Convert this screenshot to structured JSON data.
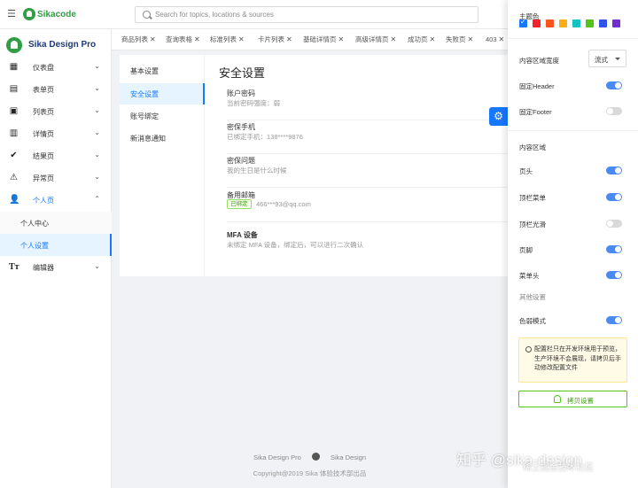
{
  "topbar": {
    "brand": "Sikacode",
    "search_placeholder": "Search for topics, locations & sources"
  },
  "sidebar": {
    "brand": "Sika Design Pro",
    "items": [
      {
        "label": "仪表盘",
        "icon": "dashboard-icon"
      },
      {
        "label": "表单页",
        "icon": "form-icon"
      },
      {
        "label": "列表页",
        "icon": "list-icon"
      },
      {
        "label": "详情页",
        "icon": "detail-icon"
      },
      {
        "label": "结果页",
        "icon": "result-icon"
      },
      {
        "label": "异常页",
        "icon": "warning-icon"
      },
      {
        "label": "个人页",
        "icon": "user-icon"
      },
      {
        "label": "编辑器",
        "icon": "editor-icon"
      }
    ],
    "sub_items": [
      {
        "label": "个人中心"
      },
      {
        "label": "个人设置"
      }
    ]
  },
  "tabs": [
    "商品列表",
    "查询表格",
    "标准列表",
    "卡片列表",
    "基础详情页",
    "高级详情页",
    "成功页",
    "失败页",
    "403"
  ],
  "settings_nav": [
    "基本设置",
    "安全设置",
    "账号绑定",
    "新消息通知"
  ],
  "security": {
    "title": "安全设置",
    "rows": [
      {
        "title": "账户密码",
        "desc": "当前密码强度：弱"
      },
      {
        "title": "密保手机",
        "desc": "已绑定手机：138****9876"
      },
      {
        "title": "密保问题",
        "desc": "我的生日是什么时候"
      },
      {
        "title": "备用邮箱",
        "badge": "已绑定",
        "desc": "466***93@qq.com"
      },
      {
        "title": "MFA 设备",
        "desc": "未绑定 MFA 设备，绑定后，可以进行二次确认"
      }
    ]
  },
  "footer": {
    "link1": "Sika Design Pro",
    "link2": "Sika Design",
    "copyright": "Copyright@2019 Sika 体验技术部出品"
  },
  "drawer": {
    "theme_color_label": "主题色",
    "colors": [
      "#1677ff",
      "#f5222d",
      "#fa541c",
      "#faad14",
      "#13c2c2",
      "#52c41a",
      "#2f54eb",
      "#722ed1"
    ],
    "content_width_label": "内容区域宽度",
    "content_width_value": "流式",
    "fixed_header_label": "固定Header",
    "fixed_footer_label": "固定Footer",
    "content_area_label": "内容区域",
    "header_label": "页头",
    "top_menu_label": "顶栏菜单",
    "top_smooth_label": "顶栏光滑",
    "page_footer_label": "页脚",
    "menu_header_label": "菜单头",
    "other_settings_label": "其他设置",
    "color_weak_label": "色弱模式",
    "notice": "配置栏只在开发环境用于预览，生产环境不会展现，请拷贝后手动修改配置文件",
    "copy_button": "拷贝设置"
  },
  "watermark": {
    "main": "知乎 @sika-design",
    "sub": "稀土掘金技术社区"
  }
}
